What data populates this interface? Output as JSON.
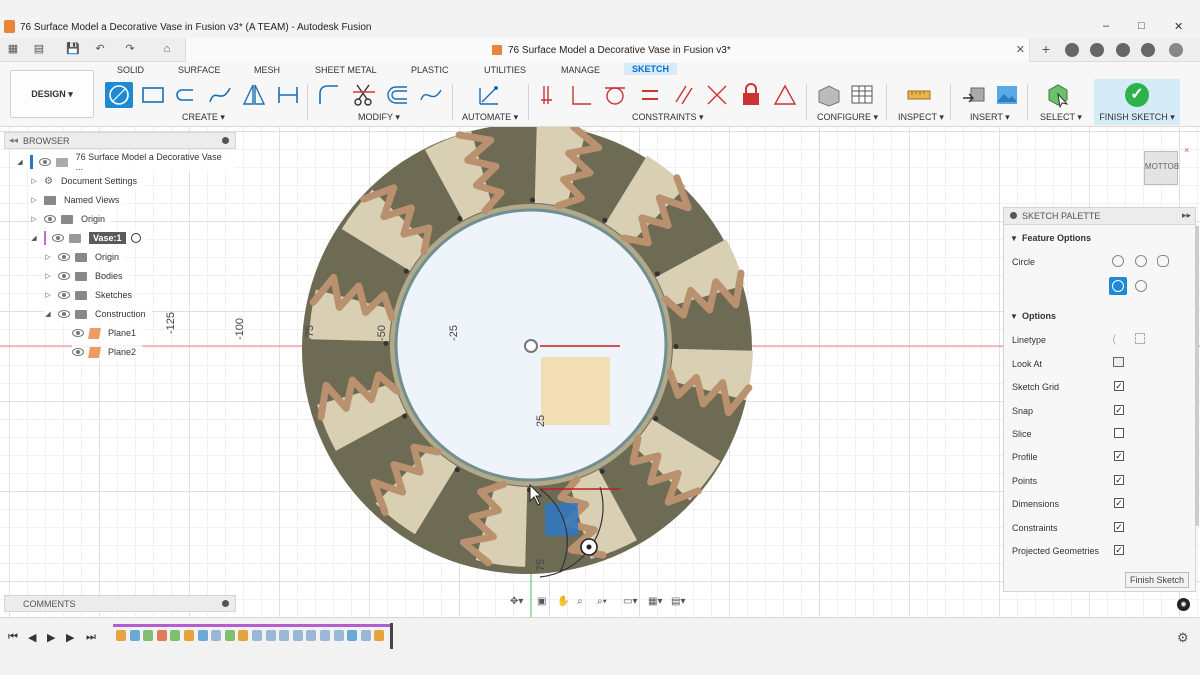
{
  "window": {
    "title": "76 Surface Model a Decorative Vase in Fusion v3* (A TEAM) - Autodesk Fusion",
    "minimize": "–",
    "maximize": "□",
    "close": "✕"
  },
  "document_tab": {
    "label": "76 Surface Model a Decorative Vase in Fusion v3*",
    "close": "✕"
  },
  "workspace": {
    "design_label": "DESIGN ▾",
    "tabs": [
      "SOLID",
      "SURFACE",
      "MESH",
      "SHEET METAL",
      "PLASTIC",
      "UTILITIES",
      "MANAGE",
      "SKETCH"
    ],
    "active_tab": "SKETCH"
  },
  "toolbar_groups": {
    "create": "CREATE ▾",
    "modify": "MODIFY ▾",
    "automate": "AUTOMATE ▾",
    "constraints": "CONSTRAINTS ▾",
    "configure": "CONFIGURE ▾",
    "inspect": "INSPECT ▾",
    "insert": "INSERT ▾",
    "select": "SELECT ▾",
    "finish_sketch": "FINISH SKETCH ▾"
  },
  "browser": {
    "title": "BROWSER",
    "items": [
      {
        "label": "76 Surface Model a Decorative Vase ..."
      },
      {
        "label": "Document Settings"
      },
      {
        "label": "Named Views"
      },
      {
        "label": "Origin"
      },
      {
        "label": "Vase:1"
      },
      {
        "label": "Origin"
      },
      {
        "label": "Bodies"
      },
      {
        "label": "Sketches"
      },
      {
        "label": "Construction"
      },
      {
        "label": "Plane1"
      },
      {
        "label": "Plane2"
      }
    ]
  },
  "comments": {
    "title": "COMMENTS"
  },
  "viewcube": {
    "label": "BOTTOM"
  },
  "canvas": {
    "axis_labels": [
      "-125",
      "-100",
      "-75",
      "-50",
      "-25",
      "25",
      "75"
    ]
  },
  "palette": {
    "title": "SKETCH PALETTE",
    "feature_options": "Feature Options",
    "circle_label": "Circle",
    "options_title": "Options",
    "options": [
      {
        "label": "Linetype",
        "type": "icons"
      },
      {
        "label": "Look At",
        "type": "icon"
      },
      {
        "label": "Sketch Grid",
        "checked": true
      },
      {
        "label": "Snap",
        "checked": true
      },
      {
        "label": "Slice",
        "checked": false
      },
      {
        "label": "Profile",
        "checked": true
      },
      {
        "label": "Points",
        "checked": true
      },
      {
        "label": "Dimensions",
        "checked": true
      },
      {
        "label": "Constraints",
        "checked": true
      },
      {
        "label": "Projected Geometries",
        "checked": true
      }
    ],
    "finish_button": "Finish Sketch"
  },
  "colors": {
    "accent": "#0a6ec7",
    "ring_dark": "#6e6b55",
    "ring_light": "#d9cfb3",
    "wave": "#b9916f",
    "finish_green": "#2db24c"
  }
}
